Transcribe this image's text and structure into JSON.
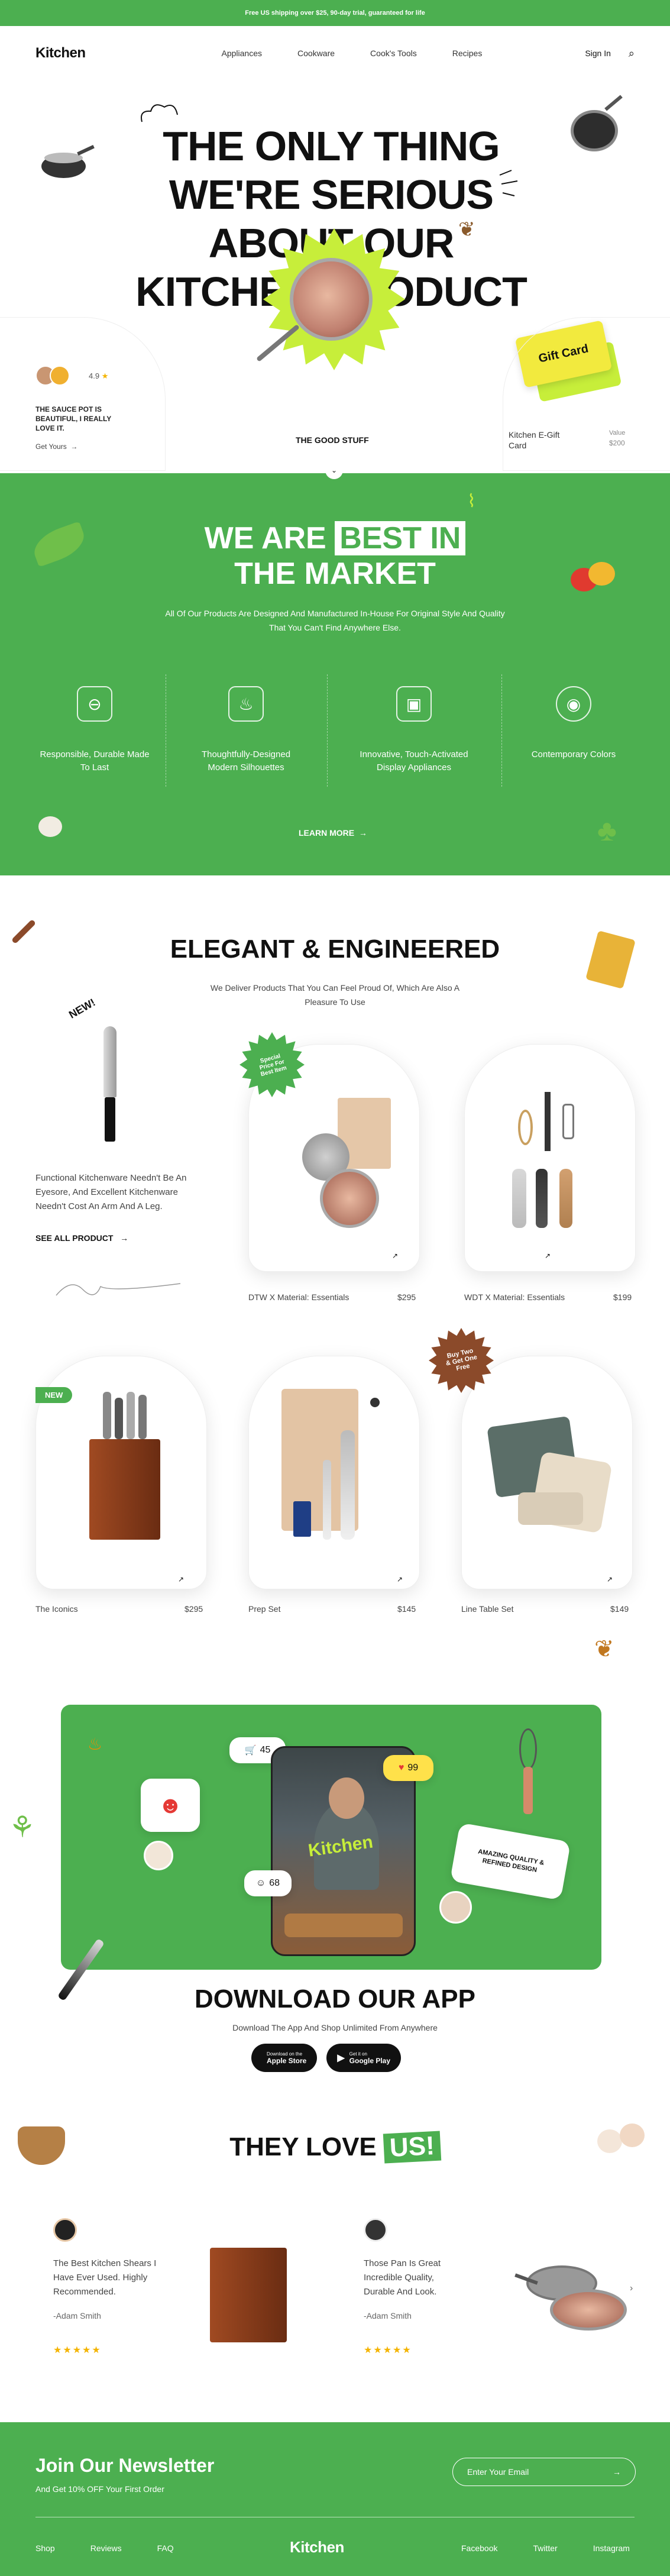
{
  "topbar": {
    "text": "Free US shipping over $25, 90-day trial, guaranteed for life"
  },
  "nav": {
    "logo": "Kitchen",
    "links": [
      "Appliances",
      "Cookware",
      "Cook's Tools",
      "Recipes"
    ],
    "sign_in": "Sign In"
  },
  "hero": {
    "title_lines": [
      "THE ONLY THING",
      "WE'RE SERIOUS",
      "ABOUT OUR",
      "KITCHEN PRODUCT"
    ],
    "rating": "4.9",
    "review_text": "THE SAUCE POT IS BEAUTIFUL, I REALLY LOVE IT.",
    "get_yours": "Get Yours",
    "good_stuff": "THE GOOD STUFF",
    "gift_card_label": "Gift Card",
    "gift_card_name": "Kitchen E-Gift Card",
    "gift_value_label": "Value",
    "gift_value": "$200"
  },
  "market": {
    "title_a": "WE ARE ",
    "title_b": "BEST IN",
    "title_c": "THE MARKET",
    "subtitle": "All Of Our Products Are Designed And Manufactured In-House For Original Style And Quality That You Can't Find Anywhere Else.",
    "features": [
      {
        "icon": "saucepan-icon",
        "label": "Responsible, Durable Made To Last"
      },
      {
        "icon": "kettle-icon",
        "label": "Thoughtfully-Designed Modern Silhouettes"
      },
      {
        "icon": "microwave-icon",
        "label": "Innovative, Touch-Activated Display Appliances"
      },
      {
        "icon": "palette-icon",
        "label": "Contemporary Colors"
      }
    ],
    "learn_more": "LEARN MORE"
  },
  "elegant": {
    "title": "ELEGANT & ENGINEERED",
    "subtitle": "We Deliver Products That You Can Feel Proud Of, Which Are Also A Pleasure To Use",
    "new_tag": "NEW!",
    "desc": "Functional Kitchenware Needn't Be An Eyesore, And Excellent Kitchenware Needn't Cost An Arm And A Leg.",
    "see_all": "SEE ALL PRODUCT",
    "special_badge": "Special Price For Best Item",
    "promo_badge": "Buy Two & Get One Free",
    "new_label": "NEW",
    "products": [
      {
        "name": "DTW X Material: Essentials",
        "price": "$295"
      },
      {
        "name": "WDT X Material: Essentials",
        "price": "$199"
      },
      {
        "name": "The Iconics",
        "price": "$295"
      },
      {
        "name": "Prep Set",
        "price": "$145"
      },
      {
        "name": "Line Table Set",
        "price": "$149"
      }
    ]
  },
  "app": {
    "likes": "45",
    "hearts": "99",
    "views": "68",
    "quality_text": "AMAZING QUALITY & REFINED DESIGN",
    "phone_brand": "Kitchen",
    "title": "DOWNLOAD OUR APP",
    "subtitle": "Download The App And Shop Unlimited From Anywhere",
    "apple_small": "Download on the",
    "apple": "Apple Store",
    "google_small": "Get it on",
    "google": "Google Play"
  },
  "testimonials": {
    "title_a": "THEY LOVE",
    "title_b": "US!",
    "items": [
      {
        "quote": "The Best Kitchen Shears I Have Ever Used. Highly Recommended.",
        "author": "-Adam Smith",
        "stars": "★★★★★"
      },
      {
        "quote": "Those Pan Is Great Incredible Quality, Durable And Look.",
        "author": "-Adam Smith",
        "stars": "★★★★★"
      }
    ]
  },
  "newsletter": {
    "title": "Join Our Newsletter",
    "subtitle": "And Get 10% OFF Your First Order",
    "placeholder": "Enter Your Email"
  },
  "footer": {
    "links_left": [
      "Shop",
      "Reviews",
      "FAQ"
    ],
    "logo": "Kitchen",
    "links_right": [
      "Facebook",
      "Twitter",
      "Instagram"
    ]
  },
  "colors": {
    "brand_green": "#4caf50",
    "lime": "#c7ee3a",
    "gift_yellow": "#f2ea3e"
  }
}
